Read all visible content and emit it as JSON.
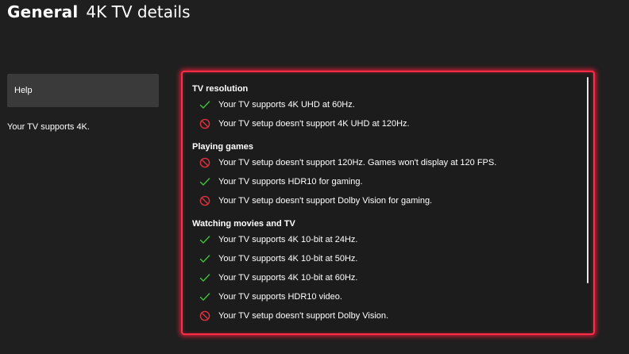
{
  "header": {
    "section": "General",
    "title": "4K TV details"
  },
  "sidebar": {
    "help_label": "Help",
    "summary": "Your TV supports 4K."
  },
  "colors": {
    "check": "#3ec13e",
    "not_supported": "#e0303f",
    "focus_border": "#ff2d47"
  },
  "groups": [
    {
      "title": "TV resolution",
      "items": [
        {
          "status": "check",
          "icon": "checkmark-icon",
          "text": "Your TV supports 4K UHD at 60Hz."
        },
        {
          "status": "no",
          "icon": "not-supported-icon",
          "text": "Your TV setup doesn't support 4K UHD at 120Hz."
        }
      ]
    },
    {
      "title": "Playing games",
      "items": [
        {
          "status": "no",
          "icon": "not-supported-icon",
          "text": "Your TV setup doesn't support 120Hz. Games won't display at 120 FPS."
        },
        {
          "status": "check",
          "icon": "checkmark-icon",
          "text": "Your TV supports HDR10 for gaming."
        },
        {
          "status": "no",
          "icon": "not-supported-icon",
          "text": "Your TV setup doesn't support Dolby Vision for gaming."
        }
      ]
    },
    {
      "title": "Watching movies and TV",
      "items": [
        {
          "status": "check",
          "icon": "checkmark-icon",
          "text": "Your TV supports 4K 10-bit at 24Hz."
        },
        {
          "status": "check",
          "icon": "checkmark-icon",
          "text": "Your TV supports 4K 10-bit at 50Hz."
        },
        {
          "status": "check",
          "icon": "checkmark-icon",
          "text": "Your TV supports 4K 10-bit at 60Hz."
        },
        {
          "status": "check",
          "icon": "checkmark-icon",
          "text": "Your TV supports HDR10 video."
        },
        {
          "status": "no",
          "icon": "not-supported-icon",
          "text": "Your TV setup doesn't support Dolby Vision."
        }
      ]
    }
  ]
}
